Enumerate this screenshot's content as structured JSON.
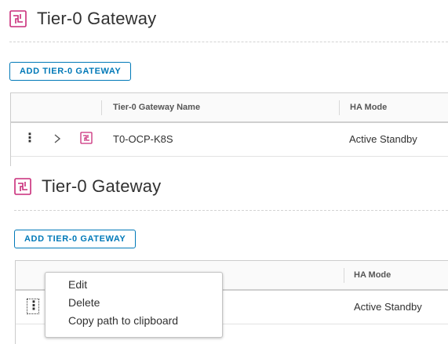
{
  "colors": {
    "accent": "#0079b8",
    "gateway_icon": "#c92c7a",
    "text": "#313131"
  },
  "page": {
    "title": "Tier-0 Gateway",
    "title_icon": "tier0-gateway-icon",
    "add_button_label": "ADD TIER-0 GATEWAY"
  },
  "grid": {
    "columns": {
      "name": "Tier-0 Gateway Name",
      "ha_mode": "HA Mode"
    },
    "row": {
      "actions_icon": "vertical-ellipsis-icon",
      "expand_icon": "chevron-right-icon",
      "type_icon": "tier0-gateway-icon",
      "name": "T0-OCP-K8S",
      "ha_mode": "Active Standby"
    }
  },
  "context_menu": {
    "items": [
      {
        "label": "Edit"
      },
      {
        "label": "Delete"
      },
      {
        "label": "Copy path to clipboard"
      }
    ]
  }
}
